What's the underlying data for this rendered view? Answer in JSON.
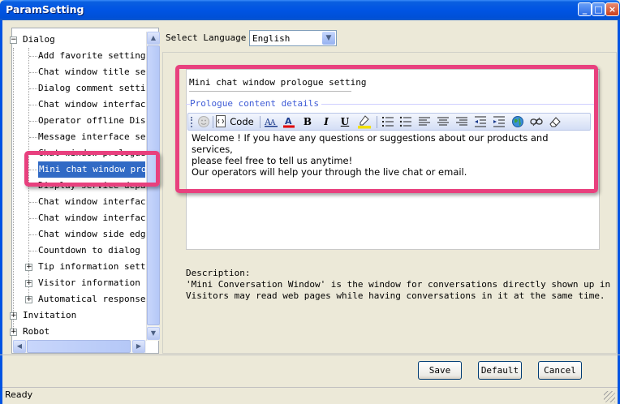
{
  "window": {
    "title": "ParamSetting",
    "min_label": "_",
    "max_label": "□",
    "close_label": "×"
  },
  "tree": {
    "rows": [
      {
        "label": "Dialog",
        "level": 0,
        "expander": "−"
      },
      {
        "label": "Add favorite setting",
        "level": 1
      },
      {
        "label": "Chat window title se",
        "level": 1
      },
      {
        "label": "Dialog comment setti",
        "level": 1
      },
      {
        "label": "Chat window interfac",
        "level": 1
      },
      {
        "label": "Operator offline Dis",
        "level": 1
      },
      {
        "label": "Message interface se",
        "level": 1
      },
      {
        "label": "Chat window prologue",
        "level": 1
      },
      {
        "label": "Mini chat window pro",
        "level": 1,
        "selected": true
      },
      {
        "label": "Display service depa",
        "level": 1
      },
      {
        "label": "Chat window interfac",
        "level": 1
      },
      {
        "label": "Chat window interfac",
        "level": 1
      },
      {
        "label": "Chat window side edg",
        "level": 1
      },
      {
        "label": "Countdown to dialog",
        "level": 1
      },
      {
        "label": "Tip information sett",
        "level": 1,
        "expander": "+"
      },
      {
        "label": "Visitor information",
        "level": 1,
        "expander": "+"
      },
      {
        "label": "Automatical response",
        "level": 1,
        "expander": "+"
      },
      {
        "label": "Invitation",
        "level": 0,
        "expander": "+"
      },
      {
        "label": "Robot",
        "level": 0,
        "expander": "+"
      }
    ]
  },
  "language": {
    "label": "Select Language",
    "value": "English"
  },
  "section": {
    "title": "Mini chat window prologue setting",
    "legend": "Prologue content details"
  },
  "toolbar": {
    "code_label": "Code",
    "bold": "B",
    "italic": "I",
    "underline": "U"
  },
  "editor": {
    "line1": "Welcome ! If you have any questions or suggestions about our products and services,",
    "line2": "please feel free to tell us anytime!",
    "line3": "Our operators will help your through the live chat or email."
  },
  "description": {
    "heading": "Description:",
    "line1": "'Mini Conversation Window' is the window for conversations directly shown up in brows",
    "line2": "Visitors may read web pages while having conversations in it at the same time."
  },
  "buttons": {
    "save": "Save",
    "default": "Default",
    "cancel": "Cancel"
  },
  "status": {
    "text": "Ready"
  },
  "colors": {
    "highlight": "#e8407e",
    "titlebar": "#0054e3",
    "selection": "#316ac5"
  }
}
